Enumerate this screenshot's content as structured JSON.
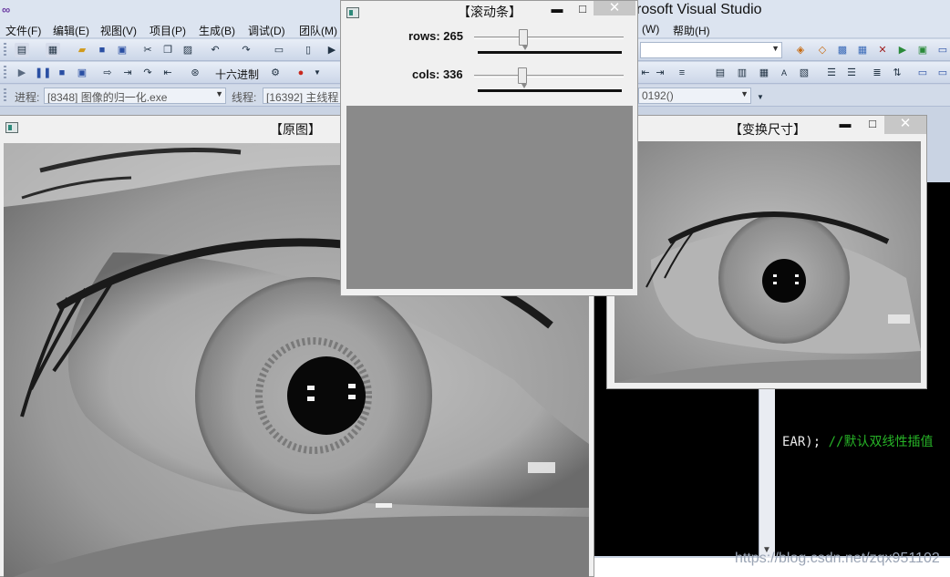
{
  "visual_studio": {
    "title_visible": "rosoft Visual Studio",
    "menu": [
      "文件(F)",
      "编辑(E)",
      "视图(V)",
      "项目(P)",
      "生成(B)",
      "调试(D)",
      "团队(M)",
      "(W)",
      "帮助(H)"
    ],
    "debug_toolbar": {
      "hex_label": "十六进制",
      "process_label": "进程:",
      "process_value": "[8348] 图像的归一化.exe",
      "thread_label": "线程:",
      "thread_value": "[16392] 主线程",
      "stack_value": "0192()"
    },
    "code_line": {
      "code": "EAR);",
      "comment": "//默认双线性插值"
    },
    "watermark": "https://blog.csdn.net/zqx951102"
  },
  "windows": {
    "original": {
      "title": "【原图】"
    },
    "resized": {
      "title": "【变换尺寸】",
      "minimize_glyph": "▬",
      "maximize_glyph": "□",
      "close_glyph": "✕"
    },
    "trackbar": {
      "title": "【滚动条】",
      "minimize_glyph": "▬",
      "maximize_glyph": "□",
      "close_glyph": "✕",
      "rows_label": "rows: 265",
      "cols_label": "cols: 336",
      "rows_value": 265,
      "cols_value": 336,
      "rows_fill": 0.32,
      "cols_fill": 0.31
    }
  },
  "colors": {
    "vs_background": "#c9d3e3",
    "code_background": "#000000",
    "comment_color": "#27b427",
    "trackbar_preview": "#8a8a8a"
  }
}
